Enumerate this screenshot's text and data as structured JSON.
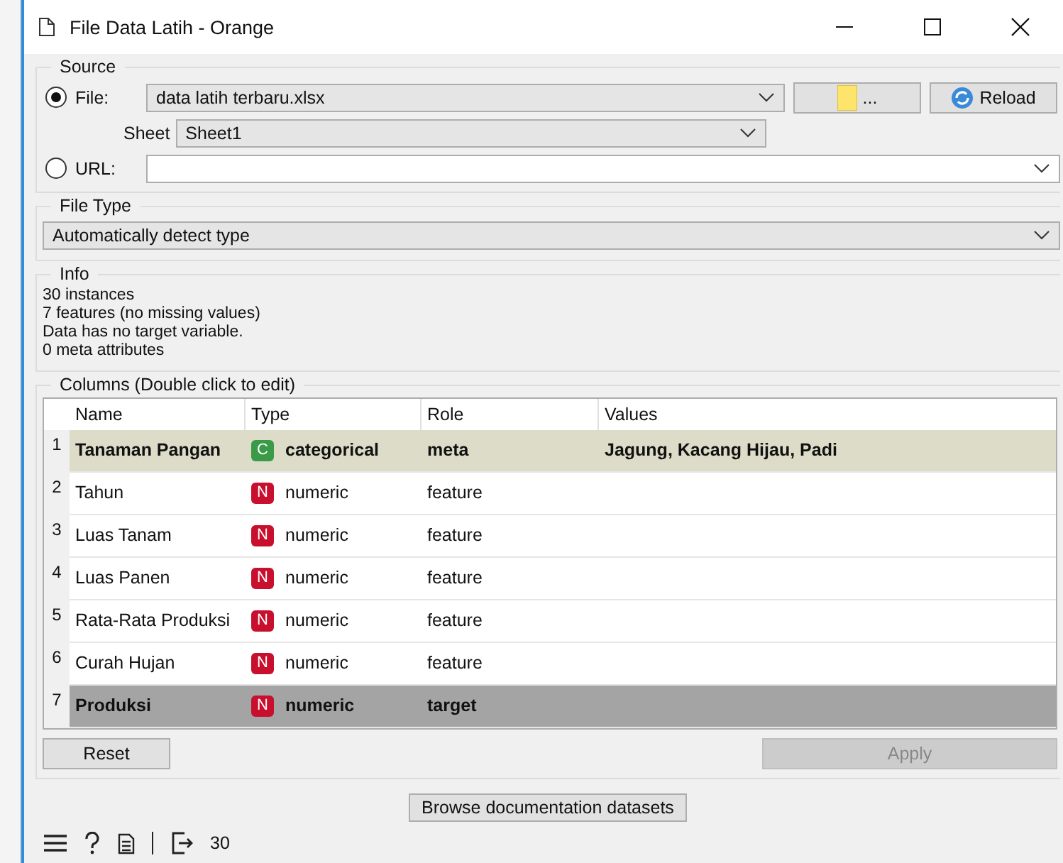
{
  "window": {
    "title": "File Data Latih - Orange"
  },
  "source": {
    "title": "Source",
    "file": {
      "label": "File:",
      "selected": true,
      "value": "data latih terbaru.xlsx"
    },
    "browse_button": {
      "label": "..."
    },
    "reload_button": {
      "label": "Reload"
    },
    "sheet": {
      "label": "Sheet",
      "value": "Sheet1"
    },
    "url": {
      "label": "URL:",
      "selected": false
    }
  },
  "file_type": {
    "title": "File Type",
    "value": "Automatically detect type"
  },
  "info": {
    "title": "Info",
    "lines": [
      "30 instances",
      "7 features (no missing values)",
      "Data has no target variable.",
      "0 meta attributes"
    ]
  },
  "columns": {
    "title": "Columns (Double click to edit)",
    "headers": [
      "Name",
      "Type",
      "Role",
      "Values"
    ],
    "rows": [
      {
        "index": "1",
        "name": "Tanaman Pangan",
        "badge": "C",
        "color": "#3a9a48",
        "type": "categorical",
        "role": "meta",
        "values": "Jagung, Kacang Hijau, Padi",
        "kind": "meta"
      },
      {
        "index": "2",
        "name": "Tahun",
        "badge": "N",
        "color": "#c8102e",
        "type": "numeric",
        "role": "feature",
        "kind": "feature"
      },
      {
        "index": "3",
        "name": "Luas Tanam",
        "badge": "N",
        "color": "#c8102e",
        "type": "numeric",
        "role": "feature",
        "kind": "feature"
      },
      {
        "index": "4",
        "name": "Luas Panen",
        "badge": "N",
        "color": "#c8102e",
        "type": "numeric",
        "role": "feature",
        "kind": "feature"
      },
      {
        "index": "5",
        "name": "Rata-Rata Produksi",
        "badge": "N",
        "color": "#c8102e",
        "type": "numeric",
        "role": "feature",
        "kind": "feature"
      },
      {
        "index": "6",
        "name": "Curah Hujan",
        "badge": "N",
        "color": "#c8102e",
        "type": "numeric",
        "role": "feature",
        "kind": "feature"
      },
      {
        "index": "7",
        "name": "Produksi",
        "badge": "N",
        "color": "#c8102e",
        "type": "numeric",
        "role": "target",
        "kind": "target"
      }
    ]
  },
  "reset_button": {
    "label": "Reset"
  },
  "apply_button": {
    "label": "Apply",
    "disabled": true
  },
  "browse_datasets_button": {
    "label": "Browse documentation datasets"
  },
  "status_bar": {
    "output_count": "30"
  }
}
